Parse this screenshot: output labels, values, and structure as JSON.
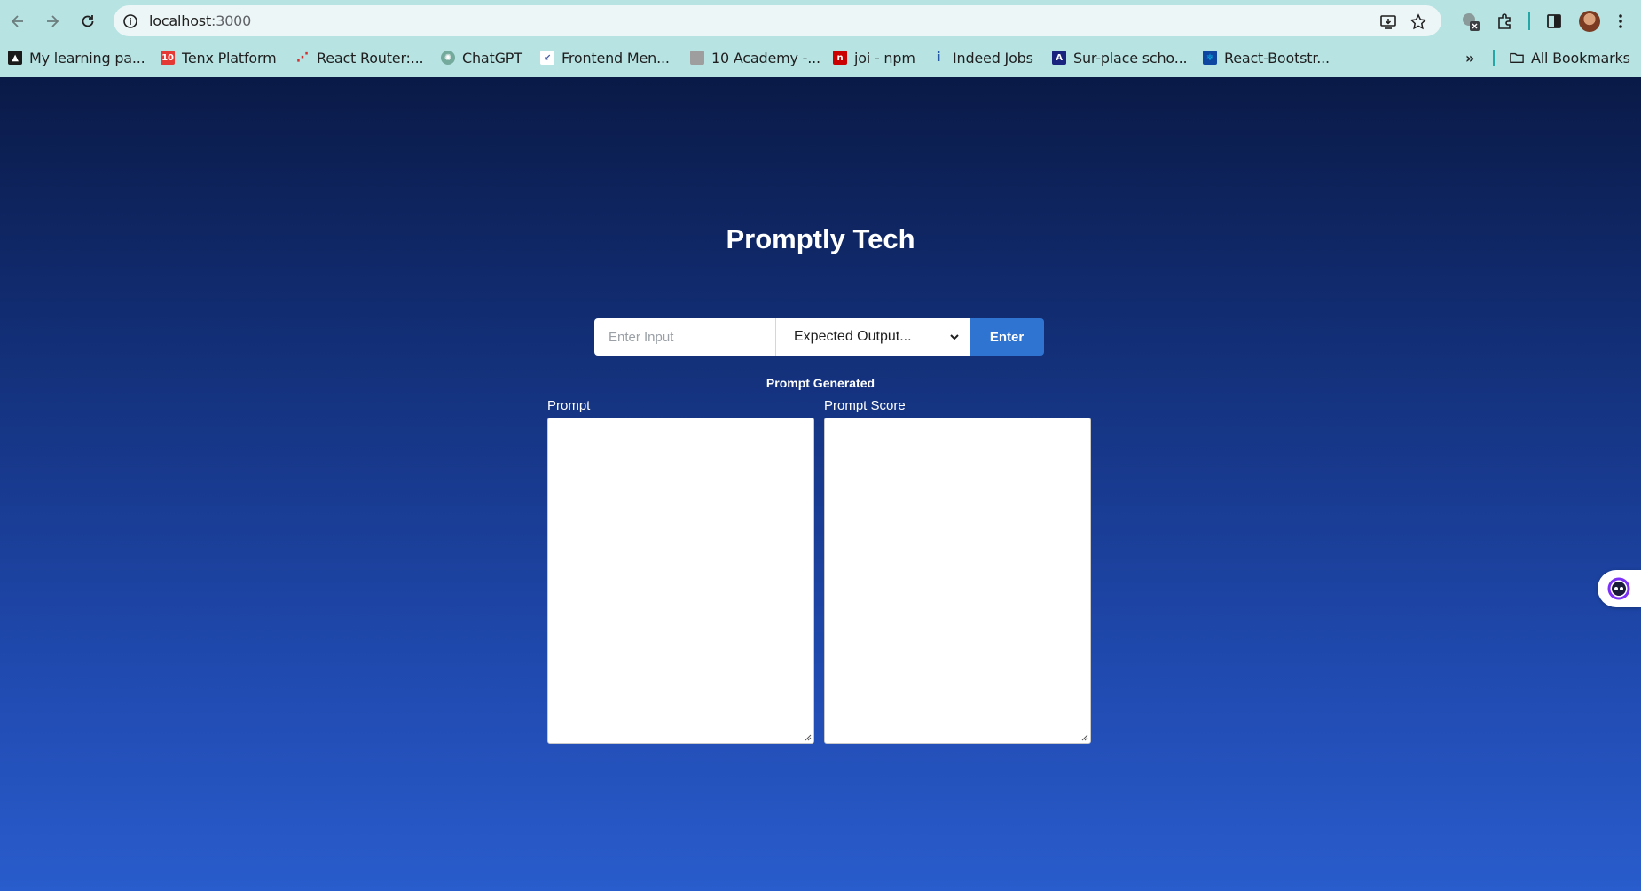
{
  "browser": {
    "url_host": "localhost",
    "url_port": ":3000",
    "bookmarks": [
      {
        "label": "My learning pa...",
        "icon": "learning-icon",
        "color": "#1a1a1a"
      },
      {
        "label": "Tenx Platform",
        "icon": "tenx-icon",
        "color": "#e53935"
      },
      {
        "label": "React Router:...",
        "icon": "react-router-icon",
        "color": "#d32f2f"
      },
      {
        "label": "ChatGPT",
        "icon": "chatgpt-icon",
        "color": "#74aa9c"
      },
      {
        "label": "Frontend Men...",
        "icon": "frontend-mentor-icon",
        "color": "#e0f0f0"
      },
      {
        "label": "10 Academy -...",
        "icon": "academy-icon",
        "color": "#9e9e9e"
      },
      {
        "label": "joi - npm",
        "icon": "npm-icon",
        "color": "#cb0000"
      },
      {
        "label": "Indeed Jobs",
        "icon": "indeed-icon",
        "color": "#2557a7"
      },
      {
        "label": "Sur-place scho...",
        "icon": "surplace-icon",
        "color": "#1a237e"
      },
      {
        "label": "React-Bootstr...",
        "icon": "react-bootstrap-icon",
        "color": "#0d47a1"
      }
    ],
    "more_bookmarks": "»",
    "all_bookmarks": "All Bookmarks"
  },
  "page": {
    "title": "Promptly Tech",
    "input_placeholder": "Enter Input",
    "select_value": "Expected Output...",
    "enter_label": "Enter",
    "section_label": "Prompt Generated",
    "prompt_label": "Prompt",
    "score_label": "Prompt Score"
  }
}
